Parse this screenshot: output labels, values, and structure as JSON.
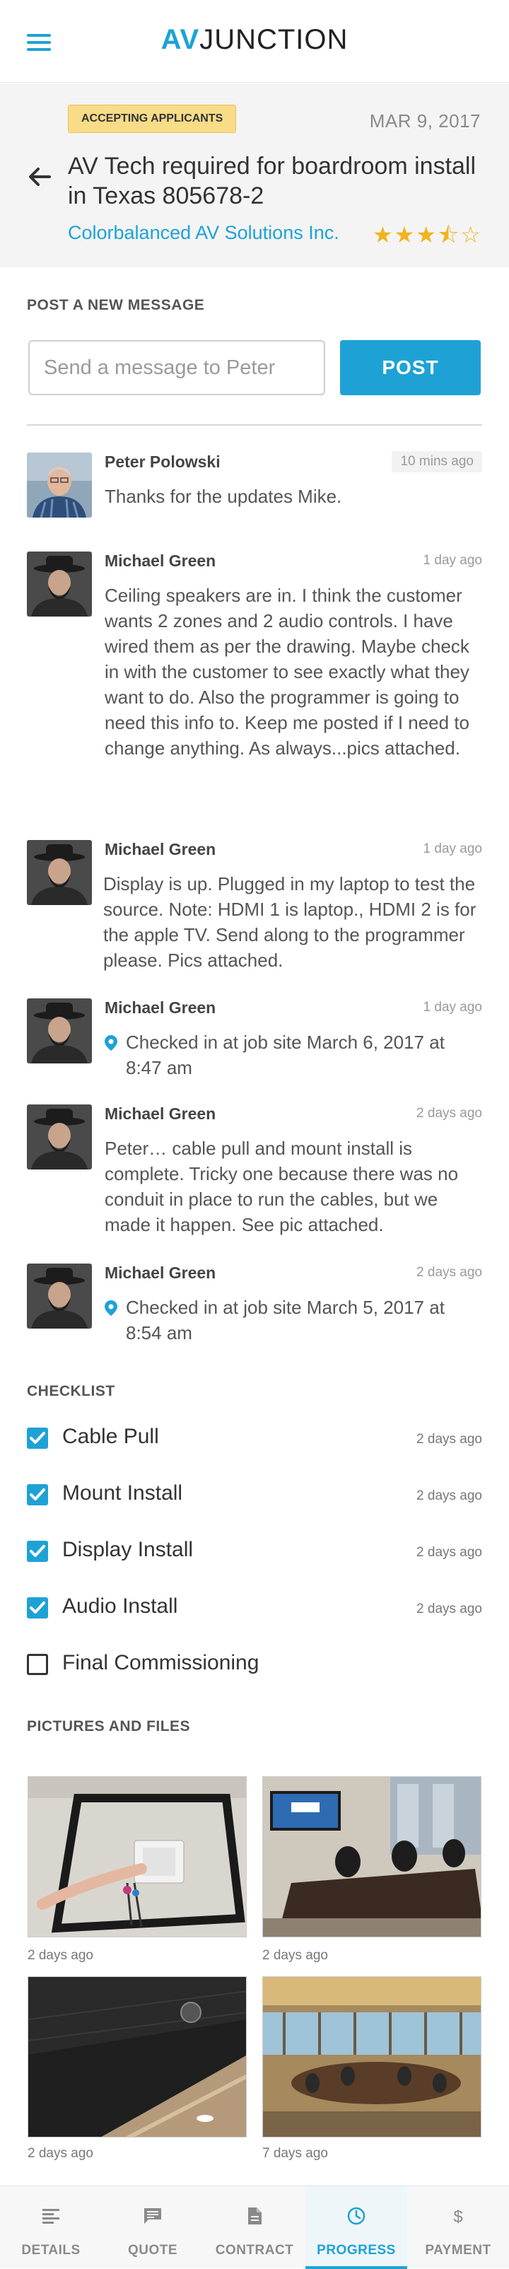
{
  "header": {
    "logo_av": "AV",
    "logo_rest": "JUNCTION"
  },
  "job": {
    "status_badge": "ACCEPTING APPLICANTS",
    "date": "MAR 9, 2017",
    "title": "AV Tech required for boardroom install in Texas 805678-2",
    "company": "Colorbalanced AV Solutions Inc.",
    "rating_stars": "★★★⯪☆",
    "rating_value": 3.5,
    "rating_max": 5
  },
  "post": {
    "section_label": "POST A NEW MESSAGE",
    "placeholder": "Send a message to Peter",
    "button_label": "POST"
  },
  "messages": [
    {
      "name": "Peter Polowski",
      "time": "10 mins ago",
      "text": "Thanks for the updates Mike."
    },
    {
      "name": "Michael Green",
      "time": "1 day ago",
      "text": "Ceiling speakers are in.  I think the customer wants 2 zones and 2 audio controls.  I have wired them as per the drawing.  Maybe check in with the customer to see exactly what they want to do.  Also the programmer is going to need this info to.  Keep me posted if I need to change anything.  As always...pics attached."
    },
    {
      "name": "Michael Green",
      "time": "1 day ago",
      "text": "Display is up.  Plugged in my laptop to test the source. Note: HDMI 1 is laptop., HDMI 2 is for the apple TV.  Send along to the programmer please. Pics attached."
    },
    {
      "name": "Michael Green",
      "time": "1 day ago",
      "text": "Checked in at job site March 6, 2017 at 8:47 am"
    },
    {
      "name": "Michael Green",
      "time": "2 days ago",
      "text": "Peter… cable pull and mount install is complete.  Tricky one because there was no conduit in place to run the cables, but we made it happen.  See pic attached."
    },
    {
      "name": "Michael Green",
      "time": "2 days ago",
      "text": "Checked in at job site March 5, 2017 at 8:54 am"
    }
  ],
  "checklist": {
    "section_label": "CHECKLIST",
    "items": [
      {
        "label": "Cable Pull",
        "date": "2 days ago",
        "checked": true
      },
      {
        "label": "Mount Install",
        "date": "2 days ago",
        "checked": true
      },
      {
        "label": "Display Install",
        "date": "2 days ago",
        "checked": true
      },
      {
        "label": "Audio Install",
        "date": "2 days ago",
        "checked": true
      },
      {
        "label": "Final Commissioning",
        "date": "",
        "checked": false
      }
    ]
  },
  "pictures": {
    "section_label": "PICTURES AND FILES",
    "items": [
      {
        "date": "2 days ago"
      },
      {
        "date": "2 days ago"
      },
      {
        "date": "2 days ago"
      },
      {
        "date": "7 days ago"
      }
    ]
  },
  "nav": {
    "items": [
      {
        "label": "DETAILS",
        "icon": "details-icon"
      },
      {
        "label": "QUOTE",
        "icon": "quote-icon"
      },
      {
        "label": "CONTRACT",
        "icon": "contract-icon"
      },
      {
        "label": "PROGRESS",
        "icon": "progress-icon",
        "active": true
      },
      {
        "label": "PAYMENT",
        "icon": "payment-icon"
      }
    ]
  },
  "colors": {
    "accent": "#1ea2d6",
    "badge": "#f8dc88",
    "stars": "#f0b41c"
  }
}
